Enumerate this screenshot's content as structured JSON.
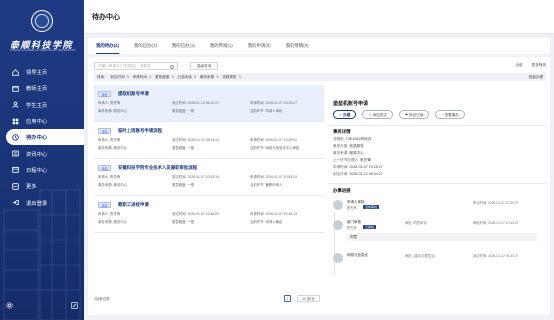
{
  "sidebar": {
    "school_name": "泰顺科技学院",
    "school_en": "TAISHUN COLLEGE OF SCIENCE AND TECHNOLOGY",
    "items": [
      {
        "label": "领导主页",
        "icon": "home-icon"
      },
      {
        "label": "教师主页",
        "icon": "teacher-icon"
      },
      {
        "label": "学生主页",
        "icon": "student-icon"
      },
      {
        "label": "应用中心",
        "icon": "grid-icon"
      },
      {
        "label": "待办中心",
        "icon": "todo-icon",
        "active": true
      },
      {
        "label": "资讯中心",
        "icon": "news-icon"
      },
      {
        "label": "日程中心",
        "icon": "calendar-icon"
      },
      {
        "label": "更多",
        "icon": "more-icon"
      },
      {
        "label": "退出登录",
        "icon": "logout-icon"
      }
    ]
  },
  "page": {
    "title": "待办中心"
  },
  "tabs": [
    {
      "label": "我的待办(4)",
      "active": true
    },
    {
      "label": "我的已办(1)"
    },
    {
      "label": "我的已办(1)"
    },
    {
      "label": "我的传阅(1)"
    },
    {
      "label": "我的申请(0)"
    },
    {
      "label": "我的草稿(0)"
    }
  ],
  "filters": {
    "search_placeholder": "可输入申请人工号(姓名)、流程名",
    "advanced": "高级查询",
    "right": [
      "全部",
      "更多筛选"
    ]
  },
  "sort_bar": {
    "label": "排序:",
    "fields": [
      "到达时间",
      "申请时间",
      "紧急程度",
      "已逾未读",
      "事务来源",
      "流程类型"
    ],
    "right": "批量办理"
  },
  "tasks": [
    {
      "tag": "待办",
      "title": "提取机账号申请",
      "applicant_label": "申请人:",
      "applicant": "陈先锋",
      "arrive_label": "到达时间:",
      "arrive": "2026-01-12 06:10:27",
      "apply_label": "申请时间:",
      "apply": "2026-01-07 10:25:27",
      "source_label": "事务来源:",
      "source": "服务中心",
      "urgency_label": "紧急程度:",
      "urgency": "一般",
      "node_label": "当前环节:",
      "node": "申请人审批"
    },
    {
      "tag": "待办",
      "title": "临时上岗账号申请流程",
      "applicant_label": "申请人:",
      "applicant": "陈先锋",
      "arrive_label": "到达时间:",
      "arrive": "2026-01-12 06:13:21",
      "apply_label": "申请时间:",
      "apply": "2026-01-07 10:09:02",
      "source_label": "事务来源:",
      "source": "服务中心",
      "urgency_label": "紧急程度:",
      "urgency": "一般",
      "node_label": "当前环节:",
      "node": "网络与信息化中心审批"
    },
    {
      "tag": "待办",
      "title": "安徽科技学院专业技术人员兼职审批流程",
      "applicant_label": "申请人:",
      "applicant": "陈先锋",
      "arrive_label": "到达时间:",
      "arrive": "2026-01-07 10:53:34",
      "apply_label": "申请时间:",
      "apply": "2026-01-07 10:53:24",
      "source_label": "事务来源:",
      "source": "服务中心",
      "urgency_label": "紧急程度:",
      "urgency": "一般",
      "node_label": "当前环节:",
      "node": "兼职申请人"
    },
    {
      "tag": "待办",
      "title": "教职工进校申请",
      "applicant_label": "申请人:",
      "applicant": "陈先锋",
      "arrive_label": "到达时间:",
      "arrive": "2026-01-07 10:46:22",
      "apply_label": "申请时间:",
      "apply": "2026-01-07 10:46:13",
      "source_label": "事务来源:",
      "source": "服务中心",
      "urgency_label": "紧急程度:",
      "urgency": "一般",
      "node_label": "当前环节:",
      "node": "申请人确定"
    }
  ],
  "pager": {
    "total": "共4条记录",
    "page": "1",
    "size": "10 条/页"
  },
  "detail": {
    "title": "堡垒机账号申请",
    "buttons": [
      "办理",
      "添加关注",
      "标记已读",
      "查看催办"
    ],
    "section": "事务详情",
    "fields": [
      {
        "k": "流程码:",
        "v": "73E10A5号待办"
      },
      {
        "k": "事务分类:",
        "v": "信息服务"
      },
      {
        "k": "事务来源:",
        "v": "服务中心"
      },
      {
        "k": "上一环节办理人:",
        "v": "陈先锋"
      },
      {
        "k": "申请时间:",
        "v": "2026-01-07 10:25:27"
      },
      {
        "k": "到达时间:",
        "v": "2026-01-12 06:34:27"
      }
    ],
    "progress_title": "办事进展",
    "steps": [
      {
        "who": "申请人审批",
        "sub": "陈先锋",
        "badge": "当前审批",
        "mid": "",
        "time_label": "申请时间:",
        "time": "2026-01-07 10:25:27",
        "comment": ""
      },
      {
        "who": "部门审核",
        "sub": "陈先锋",
        "badge": "已审批",
        "mid": "审批:  同意申请",
        "time_label": "审批时间:",
        "time": "2026-01-07 10:43:27",
        "comment": "同意"
      },
      {
        "who": "网络与信息化",
        "sub": "",
        "badge": "",
        "mid": "审批:  (建议办理意见)",
        "time_label": "到达时间:",
        "time": "2026-01-12 06:34:27",
        "comment": ""
      }
    ]
  },
  "footer": {
    "settings_icon": "gear-icon",
    "edit_icon": "edit-icon"
  }
}
